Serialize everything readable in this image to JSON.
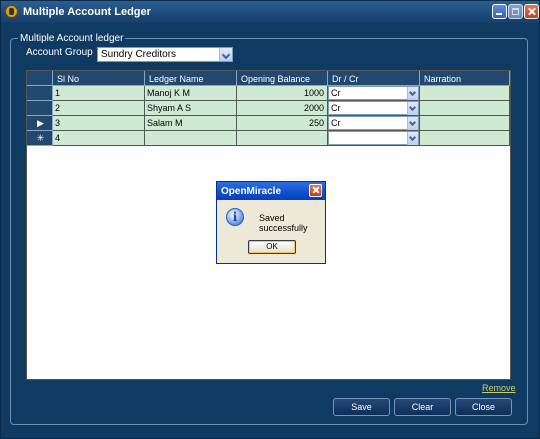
{
  "window": {
    "title": "Multiple Account Ledger"
  },
  "group": {
    "legend": "Multiple Account ledger",
    "account_group_label": "Account Group",
    "account_group_value": "Sundry Creditors"
  },
  "grid": {
    "columns": [
      "Sl No",
      "Ledger Name",
      "Opening Balance",
      "Dr / Cr",
      "Narration"
    ],
    "rows": [
      {
        "sl": "1",
        "name": "Manoj K M",
        "balance": "1000",
        "drcr": "Cr",
        "narration": ""
      },
      {
        "sl": "2",
        "name": "Shyam A S",
        "balance": "2000",
        "drcr": "Cr",
        "narration": ""
      },
      {
        "sl": "3",
        "name": "Salam M",
        "balance": "250",
        "drcr": "Cr",
        "narration": ""
      },
      {
        "sl": "4",
        "name": "",
        "balance": "",
        "drcr": "",
        "narration": ""
      }
    ],
    "row_indicators": [
      "",
      "",
      "▶",
      "✳"
    ]
  },
  "dialog": {
    "title": "OpenMiracle",
    "message": "Saved successfully",
    "ok_label": "OK",
    "icon": "info-icon"
  },
  "actions": {
    "remove_label": "Remove",
    "save_label": "Save",
    "clear_label": "Clear",
    "close_label": "Close"
  },
  "colors": {
    "window_bg": "#0f3b63",
    "grid_row_bg": "#cfead3",
    "grid_header_bg": "#23486f",
    "link": "#ccd06a"
  }
}
